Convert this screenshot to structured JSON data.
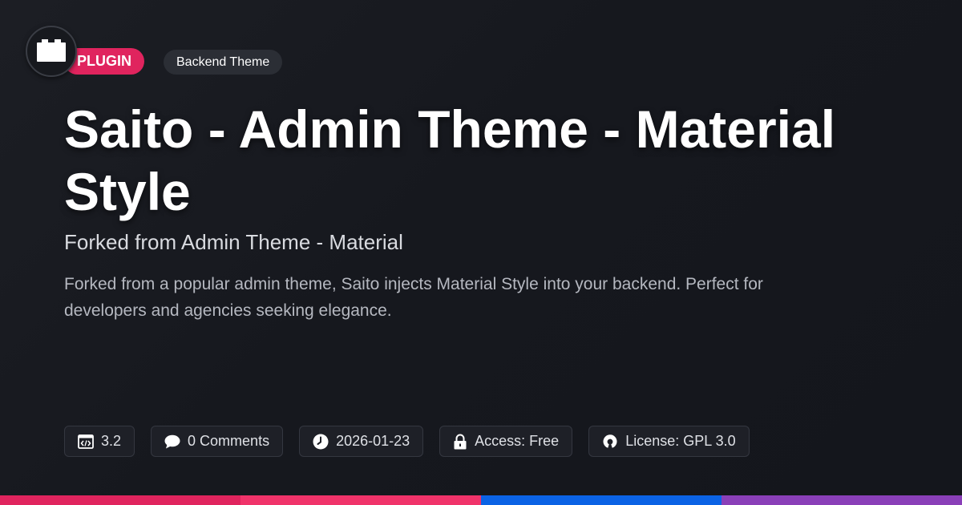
{
  "badges": {
    "type": "PLUGIN",
    "category": "Backend Theme"
  },
  "title": "Saito - Admin Theme - Material Style",
  "subtitle": "Forked from Admin Theme - Material",
  "description": "Forked from a popular admin theme, Saito injects Material Style into your backend. Perfect for developers and agencies seeking elegance.",
  "meta": {
    "version": "3.2",
    "comments": "0 Comments",
    "date": "2026-01-23",
    "access": "Access: Free",
    "license": "License: GPL 3.0"
  },
  "icons": [
    "plugin-block-icon",
    "code-window-icon",
    "speech-bubble-icon",
    "clock-icon",
    "lock-icon",
    "open-source-icon"
  ],
  "colors": {
    "plugin_badge": "#e0245e",
    "bar": [
      "#e0245e",
      "#f0336a",
      "#0b63e5",
      "#8a3fb8"
    ]
  }
}
